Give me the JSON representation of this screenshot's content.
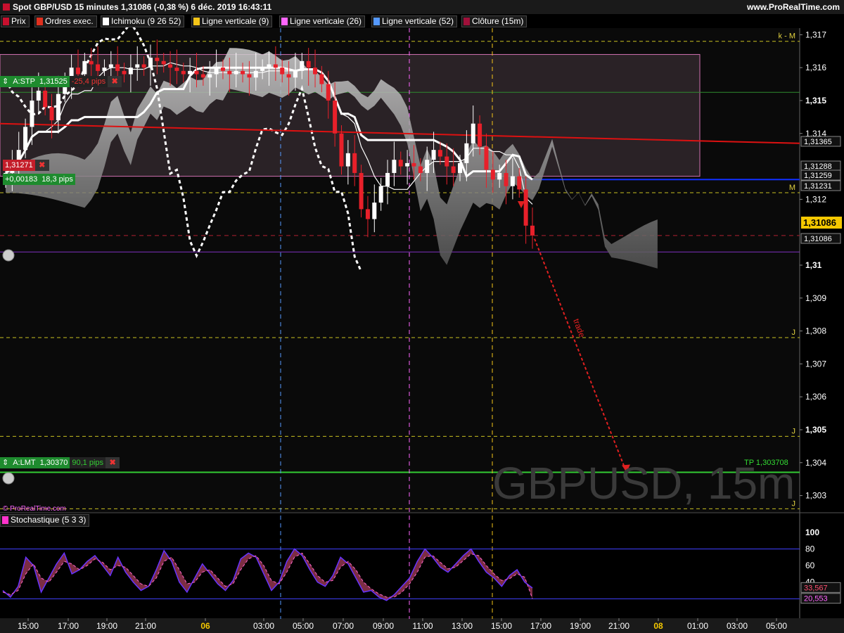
{
  "header": {
    "title": "Spot GBP/USD 15 minutes 1,31086 (-0,38 %) 6 déc. 2019 16:43:11",
    "brand": "www.ProRealTime.com"
  },
  "legend": [
    {
      "label": "Prix",
      "color": "#c8102e"
    },
    {
      "label": "Ordres exec.",
      "color": "#e0301e"
    },
    {
      "label": "Ichimoku (9 26 52)",
      "color": "#ffffff"
    },
    {
      "label": "Ligne verticale (9)",
      "color": "#f5c518"
    },
    {
      "label": "Ligne verticale (26)",
      "color": "#ff66ff"
    },
    {
      "label": "Ligne verticale (52)",
      "color": "#5599ff"
    },
    {
      "label": "Clôture (15m)",
      "color": "#a0103a"
    }
  ],
  "orders": {
    "stop": {
      "label": "A:STP",
      "price": "1,31525",
      "pips": "-25,4 pips"
    },
    "limit": {
      "label": "A:LMT",
      "price": "1,30370",
      "pips": "90,1 pips"
    },
    "entry": {
      "price": "1,31271",
      "change": "+0,00183",
      "pips": "18,3 pips"
    },
    "tp_label": "TP 1,303708",
    "trade_label": "trade"
  },
  "credit": "ProRealTime.com",
  "watermark": "GBPUSD, 15m",
  "stoch_label": "Stochastique (5 3 3)",
  "colors": {
    "up": "#ffffff",
    "down": "#e8202a",
    "cloud": "#9a9a9a",
    "trend": "#dd1111",
    "stochK": "#6633ff",
    "stochD": "#ff66cc"
  },
  "chart_data": {
    "type": "candlestick",
    "title": "Spot GBP/USD 15 minutes",
    "ylim": [
      1.3025,
      1.3172
    ],
    "y_ticks": [
      "1,317",
      "1,316",
      "1,315",
      "1,314",
      "1,312",
      "1,31",
      "1,309",
      "1,308",
      "1,307",
      "1,306",
      "1,305",
      "1,304",
      "1,303"
    ],
    "y_bold": [
      "1,315",
      "1,31",
      "1,305"
    ],
    "x_ticks": [
      "15:00",
      "17:00",
      "19:00",
      "21:00",
      "06",
      "03:00",
      "05:00",
      "07:00",
      "09:00",
      "11:00",
      "13:00",
      "15:00",
      "17:00",
      "19:00",
      "21:00",
      "08",
      "01:00",
      "03:00",
      "05:00"
    ],
    "last_price": "1,31086",
    "price_labels": [
      "1,31365",
      "1,31288",
      "1,31259",
      "1,31231",
      "1,31086"
    ],
    "level_labels": [
      {
        "text": "k - M",
        "price": 1.3168
      },
      {
        "text": "M",
        "price": 1.3122
      },
      {
        "text": "J",
        "price": 1.3078
      },
      {
        "text": "J",
        "price": 1.3048
      },
      {
        "text": "J",
        "price": 1.3026
      }
    ],
    "levels": {
      "blue": 1.3126,
      "green_upper": 1.31525,
      "green_tp": 1.303708,
      "purple": 1.3104,
      "red_dashed": 1.3109
    },
    "trend_line": [
      1.3143,
      1.3137
    ],
    "close": [
      1.3128,
      1.3131,
      1.3135,
      1.3142,
      1.315,
      1.3153,
      1.3148,
      1.3144,
      1.3152,
      1.3156,
      1.316,
      1.3158,
      1.3162,
      1.3161,
      1.3159,
      1.316,
      1.3161,
      1.3159,
      1.3158,
      1.316,
      1.3161,
      1.316,
      1.3163,
      1.3162,
      1.3161,
      1.316,
      1.3159,
      1.3158,
      1.3159,
      1.3158,
      1.3157,
      1.3158,
      1.316,
      1.3159,
      1.3158,
      1.3159,
      1.3158,
      1.3157,
      1.3159,
      1.316,
      1.3161,
      1.316,
      1.3158,
      1.3157,
      1.3159,
      1.3162,
      1.316,
      1.3158,
      1.3155,
      1.315,
      1.314,
      1.313,
      1.3134,
      1.3128,
      1.3117,
      1.3114,
      1.3119,
      1.3124,
      1.3128,
      1.3132,
      1.313,
      1.3131,
      1.313,
      1.3128,
      1.3132,
      1.3135,
      1.3133,
      1.313,
      1.3128,
      1.3131,
      1.3137,
      1.3143,
      1.3136,
      1.3129,
      1.3126,
      1.3128,
      1.3124,
      1.3127,
      1.3123,
      1.3112,
      1.3109
    ],
    "stoch": {
      "ylim": [
        0,
        110
      ],
      "ticks": [
        "100",
        "80",
        "60",
        "40"
      ],
      "k_last": "33,567",
      "d_last": "20,553",
      "k": [
        30,
        22,
        35,
        70,
        60,
        28,
        45,
        62,
        75,
        50,
        55,
        65,
        72,
        60,
        48,
        70,
        52,
        40,
        30,
        35,
        55,
        78,
        65,
        40,
        28,
        45,
        62,
        50,
        38,
        30,
        42,
        68,
        75,
        70,
        50,
        30,
        40,
        65,
        80,
        72,
        55,
        40,
        35,
        48,
        70,
        62,
        45,
        28,
        30,
        22,
        18,
        25,
        35,
        45,
        65,
        80,
        70,
        58,
        52,
        62,
        72,
        80,
        65,
        52,
        45,
        35,
        48,
        55,
        40,
        33
      ],
      "d": [
        28,
        25,
        30,
        50,
        62,
        45,
        40,
        52,
        65,
        62,
        55,
        60,
        68,
        64,
        55,
        60,
        58,
        48,
        38,
        35,
        45,
        65,
        70,
        55,
        38,
        40,
        52,
        55,
        45,
        35,
        38,
        55,
        68,
        72,
        60,
        42,
        38,
        52,
        70,
        75,
        62,
        48,
        40,
        42,
        58,
        65,
        55,
        40,
        32,
        26,
        22,
        22,
        28,
        38,
        52,
        70,
        72,
        64,
        56,
        58,
        66,
        74,
        72,
        60,
        50,
        42,
        44,
        50,
        46,
        20
      ]
    }
  }
}
